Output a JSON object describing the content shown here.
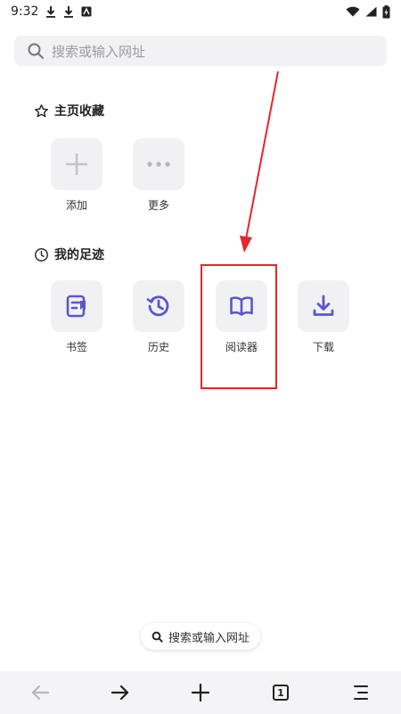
{
  "status_bar": {
    "time": "9:32",
    "icons": [
      "download-icon",
      "download-icon",
      "app-icon"
    ],
    "right_icons": [
      "wifi-icon",
      "signal-icon",
      "battery-icon"
    ]
  },
  "search": {
    "placeholder": "搜索或输入网址"
  },
  "favorites": {
    "title": "主页收藏",
    "items": [
      {
        "label": "添加",
        "icon": "plus-icon"
      },
      {
        "label": "更多",
        "icon": "more-icon"
      }
    ]
  },
  "footprints": {
    "title": "我的足迹",
    "items": [
      {
        "label": "书签",
        "icon": "bookmark-icon"
      },
      {
        "label": "历史",
        "icon": "history-icon"
      },
      {
        "label": "阅读器",
        "icon": "reader-icon"
      },
      {
        "label": "下载",
        "icon": "download-icon"
      }
    ]
  },
  "bottom_pill": {
    "label": "搜索或输入网址"
  },
  "bottom_nav": {
    "tab_count": "1",
    "buttons": [
      "back-icon",
      "forward-icon",
      "new-tab-icon",
      "tabs-icon",
      "menu-icon"
    ]
  },
  "colors": {
    "accent": "#5b57c9",
    "annotation": "#e3272b",
    "tile_bg": "#f1f1f3"
  }
}
